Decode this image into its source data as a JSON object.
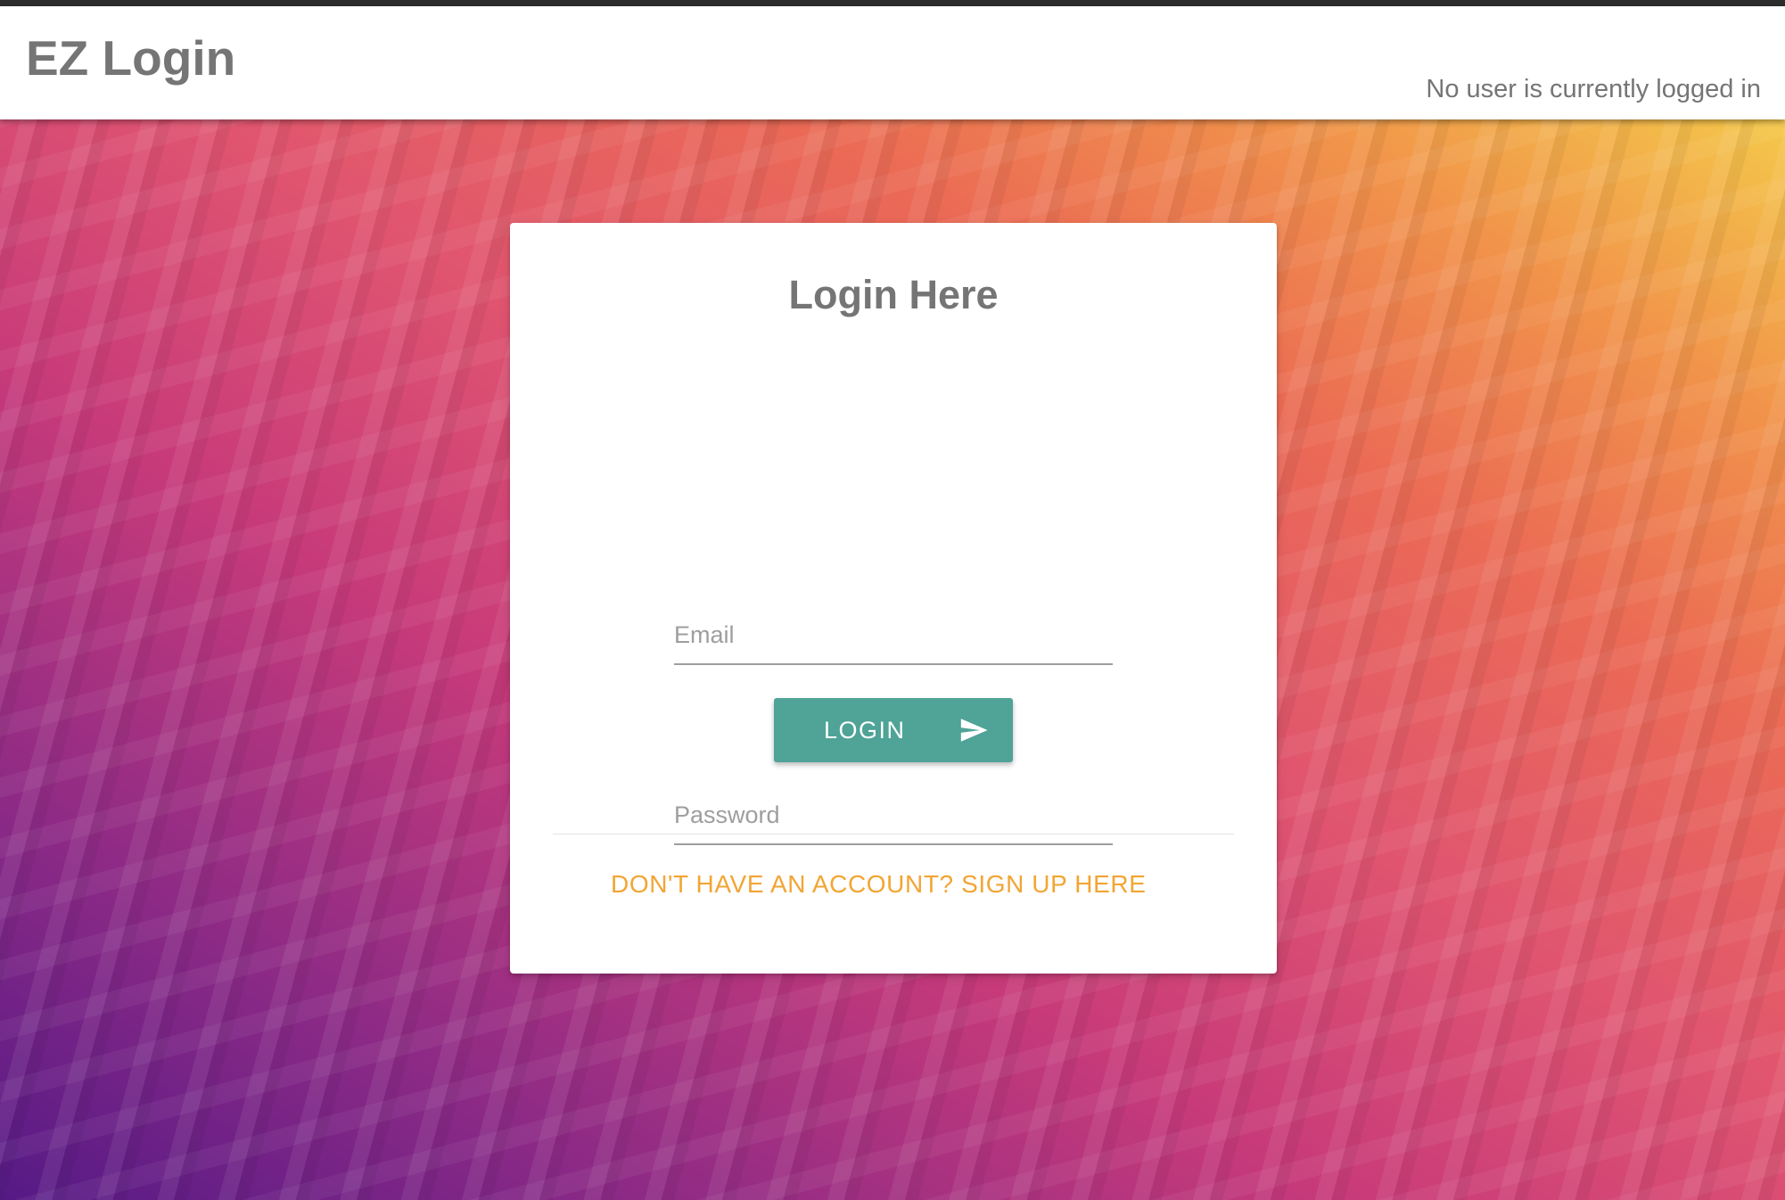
{
  "header": {
    "title": "EZ Login",
    "status_text": "No user is currently logged in"
  },
  "login_card": {
    "title": "Login Here",
    "email_placeholder": "Email",
    "password_placeholder": "Password",
    "login_button_label": "LOGIN",
    "login_button_icon": "send-icon",
    "signup_link": "DON'T HAVE AN ACCOUNT? SIGN UP HERE"
  },
  "colors": {
    "header_text": "#757575",
    "button_bg": "#4fa397",
    "link": "#f2a534",
    "background_gradient": [
      "#551a86",
      "#c73a7a",
      "#eb6a55",
      "#f4c84a"
    ]
  }
}
